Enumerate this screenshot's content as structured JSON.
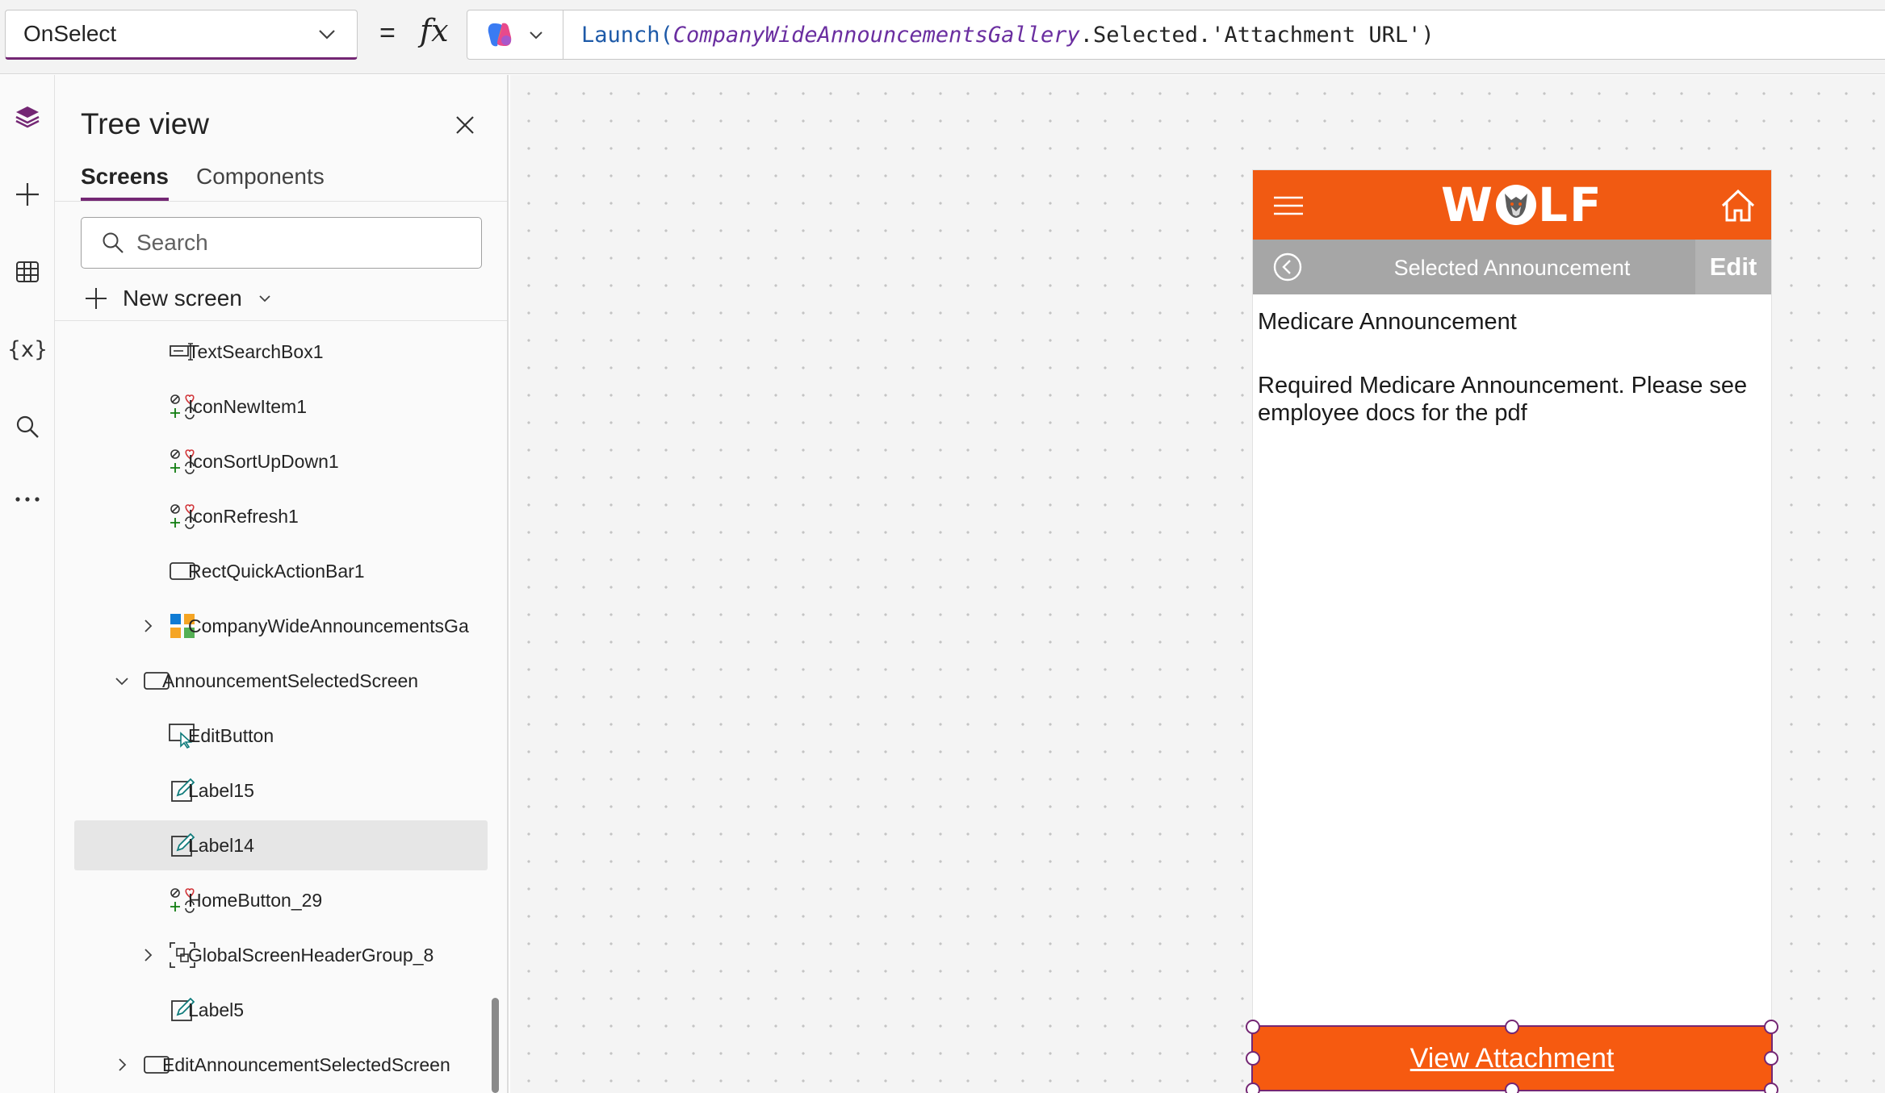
{
  "formula_bar": {
    "property": "OnSelect",
    "equals": "=",
    "fx": "fx",
    "formula": {
      "fn_open": "Launch(",
      "control": "CompanyWideAnnouncementsGallery",
      "rest": ".Selected.'Attachment URL')"
    }
  },
  "rail": {
    "items": [
      "tree-view",
      "insert",
      "data",
      "variables",
      "search",
      "more"
    ]
  },
  "tree": {
    "title": "Tree view",
    "tabs": [
      {
        "label": "Screens",
        "active": true
      },
      {
        "label": "Components",
        "active": false
      }
    ],
    "search_placeholder": "Search",
    "new_screen_label": "New screen",
    "items": [
      {
        "label": "TextSearchBox1",
        "icon": "text-input-icon",
        "level": 2
      },
      {
        "label": "IconNewItem1",
        "icon": "icons-icon",
        "level": 2
      },
      {
        "label": "IconSortUpDown1",
        "icon": "icons-icon",
        "level": 2
      },
      {
        "label": "IconRefresh1",
        "icon": "icons-icon",
        "level": 2
      },
      {
        "label": "RectQuickActionBar1",
        "icon": "rectangle-icon",
        "level": 2
      },
      {
        "label": "CompanyWideAnnouncementsGa",
        "icon": "gallery-icon",
        "level": 2,
        "expander": "collapsed"
      },
      {
        "label": "AnnouncementSelectedScreen",
        "icon": "screen-icon",
        "level": 1,
        "expander": "expanded"
      },
      {
        "label": "EditButton",
        "icon": "button-icon",
        "level": 2
      },
      {
        "label": "Label15",
        "icon": "label-icon",
        "level": 2
      },
      {
        "label": "Label14",
        "icon": "label-icon",
        "level": 2,
        "selected": true
      },
      {
        "label": "HomeButton_29",
        "icon": "icons-icon",
        "level": 2
      },
      {
        "label": "GlobalScreenHeaderGroup_8",
        "icon": "group-icon",
        "level": 2,
        "expander": "collapsed"
      },
      {
        "label": "Label5",
        "icon": "label-icon",
        "level": 2
      },
      {
        "label": "EditAnnouncementSelectedScreen",
        "icon": "screen-icon",
        "level": 1,
        "expander": "collapsed"
      }
    ]
  },
  "app": {
    "brand_left": "W",
    "brand_right": "LF",
    "header_color": "#f15a12",
    "subheader_title": "Selected Announcement",
    "edit_label": "Edit",
    "announcement_title": "Medicare Announcement",
    "announcement_body": "Required Medicare Announcement. Please see employee docs for the pdf",
    "view_attachment_label": "View Attachment"
  },
  "colors": {
    "accent": "#742774",
    "orange": "#f65a10",
    "subheader": "#a6a6a6"
  }
}
